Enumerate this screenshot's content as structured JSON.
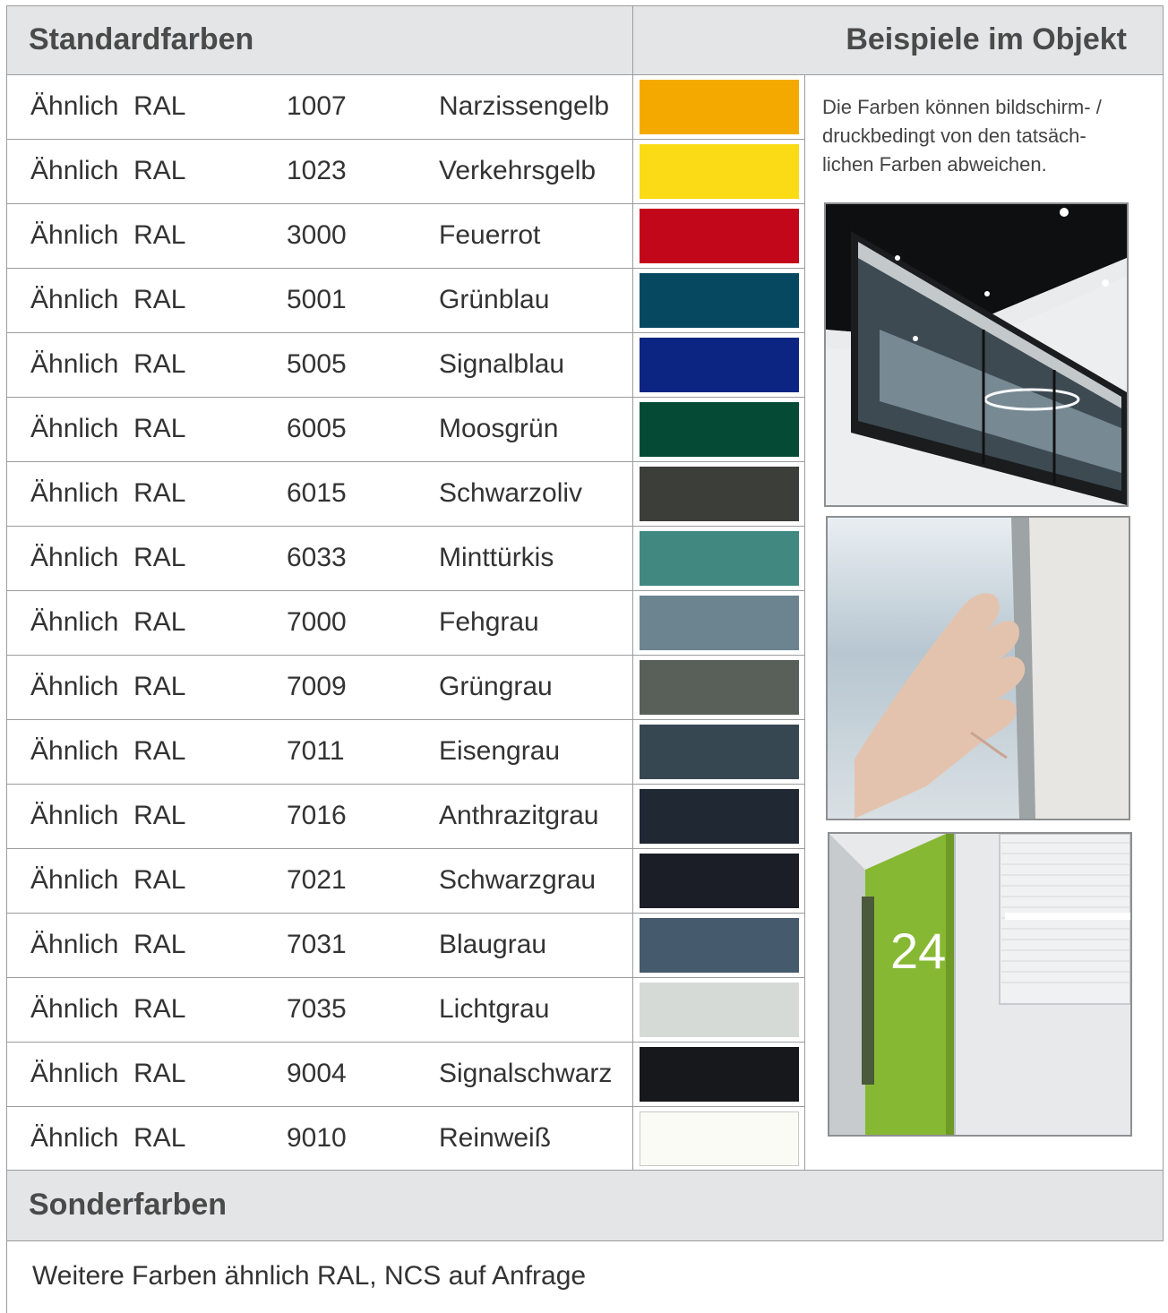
{
  "header": {
    "left_title": "Standardfarben",
    "right_title": "Beispiele im Objekt"
  },
  "colors": [
    {
      "prefix": "Ähnlich  RAL",
      "code": "1007",
      "name": "Narzissengelb",
      "hex": "#f4a900"
    },
    {
      "prefix": "Ähnlich  RAL",
      "code": "1023",
      "name": "Verkehrsgelb",
      "hex": "#fadb16"
    },
    {
      "prefix": "Ähnlich  RAL",
      "code": "3000",
      "name": "Feuerrot",
      "hex": "#c2071b"
    },
    {
      "prefix": "Ähnlich  RAL",
      "code": "5001",
      "name": "Grünblau",
      "hex": "#054860"
    },
    {
      "prefix": "Ähnlich  RAL",
      "code": "5005",
      "name": "Signalblau",
      "hex": "#0d2582"
    },
    {
      "prefix": "Ähnlich  RAL",
      "code": "6005",
      "name": "Moosgrün",
      "hex": "#054a34"
    },
    {
      "prefix": "Ähnlich  RAL",
      "code": "6015",
      "name": "Schwarzoliv",
      "hex": "#3c3e3a"
    },
    {
      "prefix": "Ähnlich  RAL",
      "code": "6033",
      "name": "Minttürkis",
      "hex": "#418980"
    },
    {
      "prefix": "Ähnlich  RAL",
      "code": "7000",
      "name": "Fehgrau",
      "hex": "#6c8490"
    },
    {
      "prefix": "Ähnlich  RAL",
      "code": "7009",
      "name": "Grüngrau",
      "hex": "#59605a"
    },
    {
      "prefix": "Ähnlich  RAL",
      "code": "7011",
      "name": "Eisengrau",
      "hex": "#364752"
    },
    {
      "prefix": "Ähnlich  RAL",
      "code": "7016",
      "name": "Anthrazitgrau",
      "hex": "#1f2833"
    },
    {
      "prefix": "Ähnlich  RAL",
      "code": "7021",
      "name": "Schwarzgrau",
      "hex": "#1b1e27"
    },
    {
      "prefix": "Ähnlich  RAL",
      "code": "7031",
      "name": "Blaugrau",
      "hex": "#455a6c"
    },
    {
      "prefix": "Ähnlich  RAL",
      "code": "7035",
      "name": "Lichtgrau",
      "hex": "#d5dad7"
    },
    {
      "prefix": "Ähnlich  RAL",
      "code": "9004",
      "name": "Signalschwarz",
      "hex": "#17181c"
    },
    {
      "prefix": "Ähnlich  RAL",
      "code": "9010",
      "name": "Reinweiß",
      "hex": "#fbfbf6"
    }
  ],
  "note": "Die Farben können bildschirm- / druckbedingt von den tatsäch-lichen Farben abweichen.",
  "note_lines": [
    "Die Farben können bildschirm- /",
    "druckbedingt von den tatsäch-",
    "lichen Farben abweichen."
  ],
  "photo_door_number": "24",
  "special": {
    "title": "Sonderfarben",
    "text": "Weitere Farben ähnlich RAL, NCS auf Anfrage"
  }
}
